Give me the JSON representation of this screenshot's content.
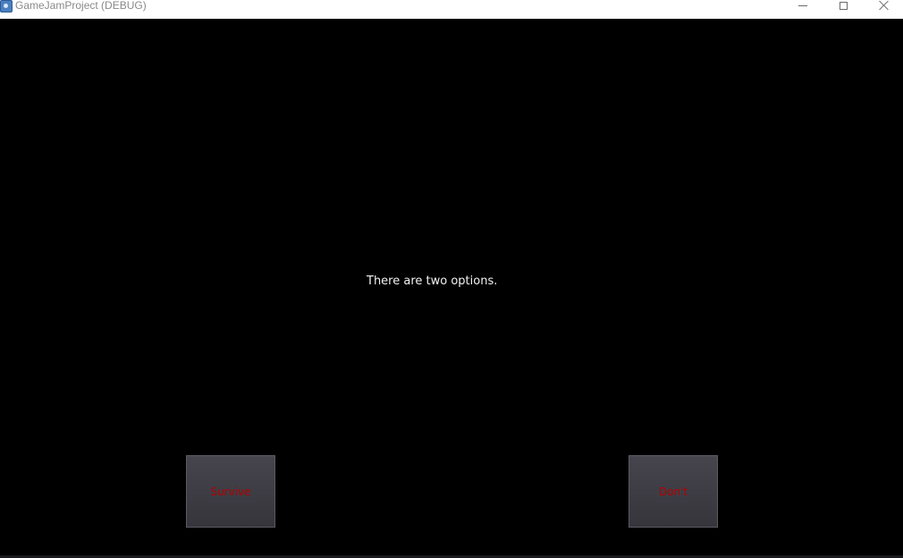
{
  "window": {
    "title": "GameJamProject (DEBUG)",
    "icon": "godot-app-icon",
    "controls": [
      "minimize-icon",
      "maximize-icon",
      "close-icon"
    ]
  },
  "game": {
    "dialog_text": "There are two options.",
    "choices": [
      {
        "label": "Survive"
      },
      {
        "label": "Don't"
      }
    ],
    "colors": {
      "background": "#000000",
      "dialog_text": "#f2f2f2",
      "button_face": "#3e3d44",
      "button_label": "#b30000"
    }
  }
}
